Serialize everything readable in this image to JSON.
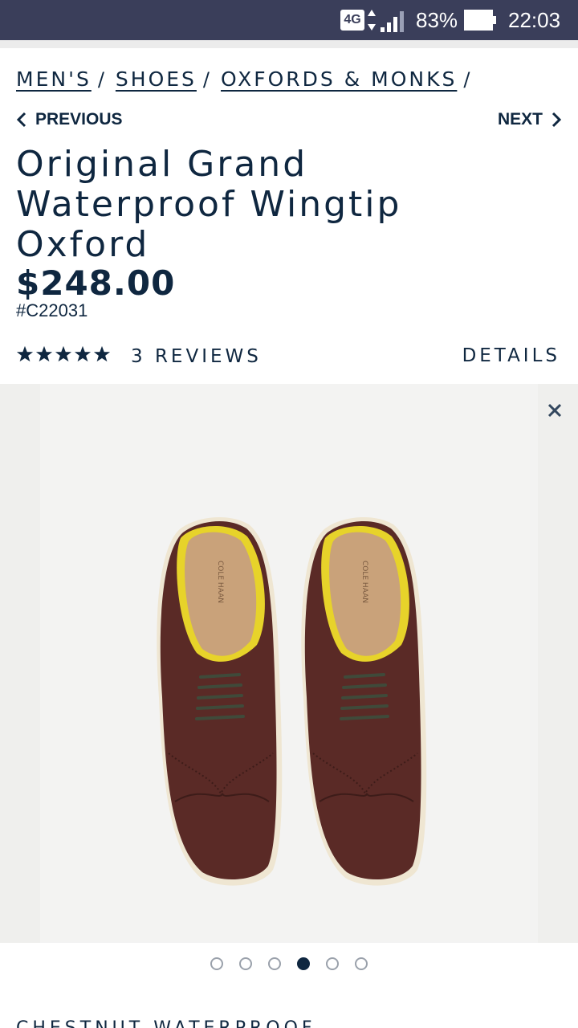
{
  "status_bar": {
    "network": "4G",
    "battery_percent": "83%",
    "time": "22:03",
    "icons": [
      "network-4g-icon",
      "data-arrows-icon",
      "signal-icon",
      "battery-icon"
    ]
  },
  "breadcrumb": {
    "items": [
      {
        "label": "MEN'S"
      },
      {
        "label": "SHOES"
      },
      {
        "label": "OXFORDS & MONKS"
      }
    ],
    "separator": "/"
  },
  "nav": {
    "previous_label": "PREVIOUS",
    "next_label": "NEXT"
  },
  "product": {
    "title": "Original Grand Waterproof Wingtip Oxford",
    "price": "$248.00",
    "sku": "#C22031",
    "rating_stars": 5,
    "reviews_label": "3 REVIEWS",
    "details_label": "DETAILS"
  },
  "gallery": {
    "image_subject": "brown wingtip oxford shoes, top view",
    "insole_brand": "COLE HAAN",
    "slide_count": 6,
    "active_slide_index": 3,
    "close_icon": "close-icon"
  },
  "next_section": {
    "heading": "CHESTNUT WATERPROOF"
  },
  "colors": {
    "navy": "#0f2740",
    "status_bar": "#3a3e5a",
    "leather": "#5a2a26",
    "insole": "#c9a27a",
    "lining": "#e7d32a",
    "sole": "#efe6d2"
  }
}
